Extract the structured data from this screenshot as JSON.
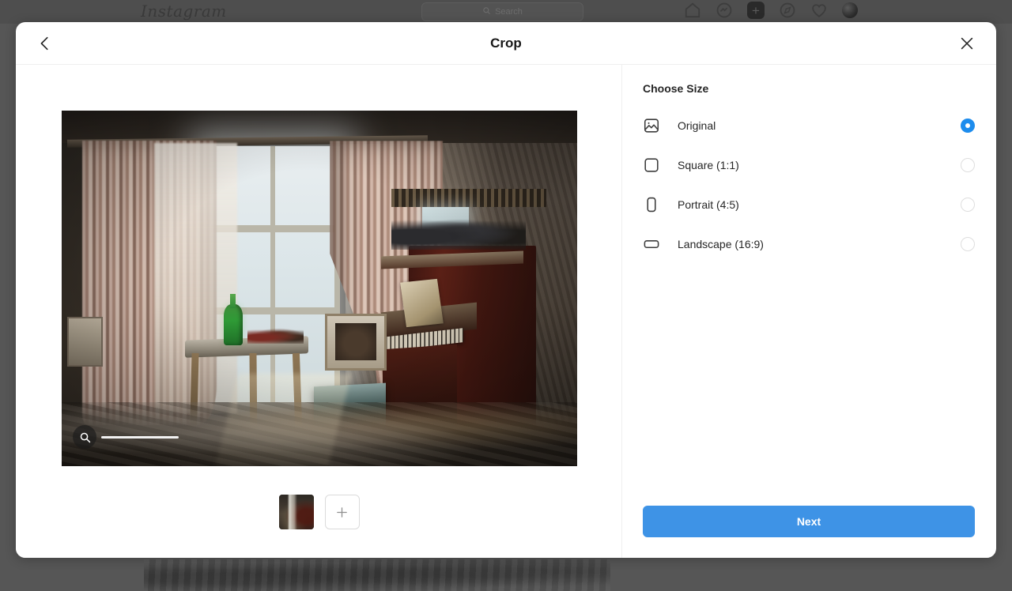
{
  "app": {
    "logo_text": "Instagram",
    "search": {
      "placeholder": "Search",
      "icon": "search-icon"
    },
    "nav_icons": [
      {
        "name": "home-icon",
        "label": "Home"
      },
      {
        "name": "messenger-icon",
        "label": "Messenger"
      },
      {
        "name": "create-post-icon",
        "label": "Create",
        "glyph": "+"
      },
      {
        "name": "explore-compass-icon",
        "label": "Explore"
      },
      {
        "name": "heart-activity-icon",
        "label": "Activity"
      },
      {
        "name": "profile-avatar",
        "label": "Profile"
      }
    ]
  },
  "modal": {
    "title": "Crop",
    "back_icon": "chevron-left-icon",
    "close_icon": "close-icon"
  },
  "editor": {
    "zoom_icon": "magnifier-icon",
    "zoom_value": 0,
    "thumbnails": [
      {
        "name": "media-thumbnail-1",
        "selected": true
      }
    ],
    "add_media_label": "+",
    "add_media_icon": "plus-icon"
  },
  "size_panel": {
    "title": "Choose Size",
    "options": [
      {
        "label": "Original",
        "icon": "photo-icon",
        "selected": true
      },
      {
        "label": "Square (1:1)",
        "icon": "square-icon",
        "selected": false
      },
      {
        "label": "Portrait (4:5)",
        "icon": "portrait-rect-icon",
        "selected": false
      },
      {
        "label": "Landscape (16:9)",
        "icon": "landscape-rect-icon",
        "selected": false
      }
    ],
    "next_label": "Next"
  },
  "colors": {
    "accent_blue": "#3e93e6",
    "radio_selected": "#1d8ced",
    "text_primary": "#262626",
    "backdrop": "#565656"
  }
}
